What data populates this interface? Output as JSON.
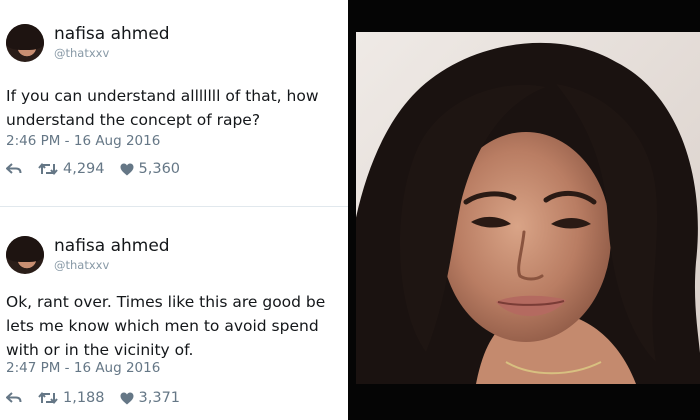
{
  "tweets": [
    {
      "name": "nafisa ahmed",
      "handle": "@thatxxv",
      "text_lines": [
        "If you can understand alllllll of that, how",
        "understand the concept of rape?"
      ],
      "timestamp": "2:46 PM - 16 Aug 2016",
      "retweets": "4,294",
      "likes": "5,360"
    },
    {
      "name": "nafisa ahmed",
      "handle": "@thatxxv",
      "text_lines": [
        "Ok, rant over. Times like this are good be",
        "lets me know which men to avoid spend",
        "with or in the vicinity of."
      ],
      "timestamp": "2:47 PM - 16 Aug 2016",
      "retweets": "1,188",
      "likes": "3,371"
    }
  ],
  "icons": {
    "reply": "reply-arrow-icon",
    "retweet": "retweet-icon",
    "like": "heart-icon"
  },
  "colors": {
    "text": "#14171a",
    "muted": "#657786",
    "handle": "#8899a6",
    "photo_frame": "#050505"
  }
}
